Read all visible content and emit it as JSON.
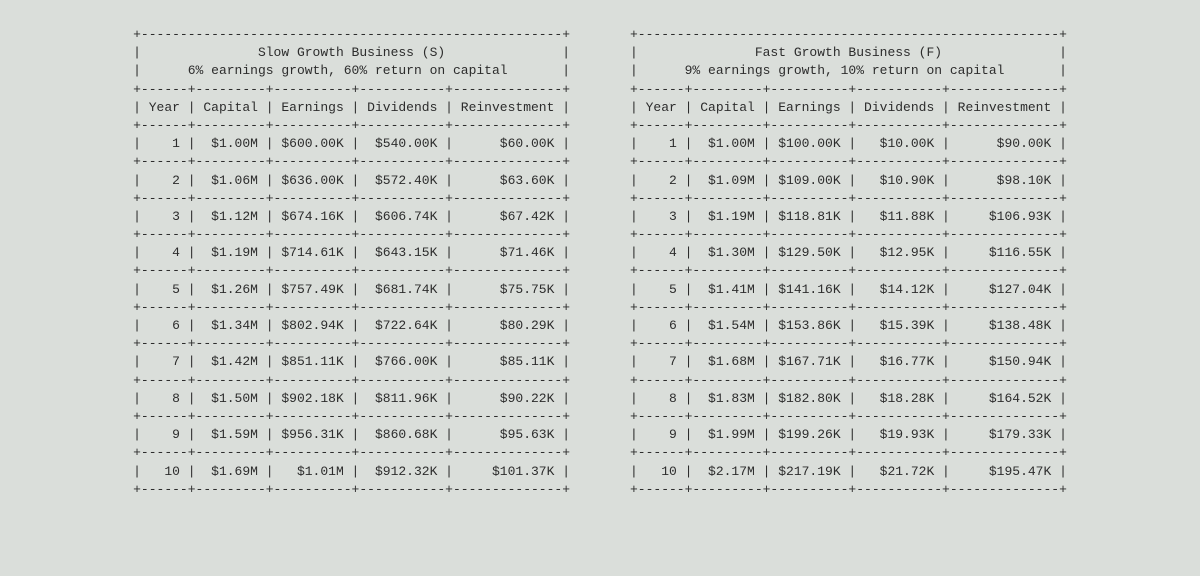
{
  "colors": {
    "bg": "#dadeda",
    "fg": "#2c2c2c"
  },
  "column_widths": {
    "year": 6,
    "capital": 9,
    "earnings": 10,
    "dividends": 11,
    "reinvestment": 14
  },
  "chart_data": [
    {
      "type": "table",
      "title": "Slow Growth Business (S)",
      "subtitle": "6% earnings growth, 60% return on capital",
      "columns": [
        "Year",
        "Capital",
        "Earnings",
        "Dividends",
        "Reinvestment"
      ],
      "rows": [
        {
          "year": 1,
          "capital": "$1.00M",
          "earnings": "$600.00K",
          "dividends": "$540.00K",
          "reinvestment": "$60.00K"
        },
        {
          "year": 2,
          "capital": "$1.06M",
          "earnings": "$636.00K",
          "dividends": "$572.40K",
          "reinvestment": "$63.60K"
        },
        {
          "year": 3,
          "capital": "$1.12M",
          "earnings": "$674.16K",
          "dividends": "$606.74K",
          "reinvestment": "$67.42K"
        },
        {
          "year": 4,
          "capital": "$1.19M",
          "earnings": "$714.61K",
          "dividends": "$643.15K",
          "reinvestment": "$71.46K"
        },
        {
          "year": 5,
          "capital": "$1.26M",
          "earnings": "$757.49K",
          "dividends": "$681.74K",
          "reinvestment": "$75.75K"
        },
        {
          "year": 6,
          "capital": "$1.34M",
          "earnings": "$802.94K",
          "dividends": "$722.64K",
          "reinvestment": "$80.29K"
        },
        {
          "year": 7,
          "capital": "$1.42M",
          "earnings": "$851.11K",
          "dividends": "$766.00K",
          "reinvestment": "$85.11K"
        },
        {
          "year": 8,
          "capital": "$1.50M",
          "earnings": "$902.18K",
          "dividends": "$811.96K",
          "reinvestment": "$90.22K"
        },
        {
          "year": 9,
          "capital": "$1.59M",
          "earnings": "$956.31K",
          "dividends": "$860.68K",
          "reinvestment": "$95.63K"
        },
        {
          "year": 10,
          "capital": "$1.69M",
          "earnings": "$1.01M",
          "dividends": "$912.32K",
          "reinvestment": "$101.37K"
        }
      ]
    },
    {
      "type": "table",
      "title": "Fast Growth Business (F)",
      "subtitle": "9% earnings growth, 10% return on capital",
      "columns": [
        "Year",
        "Capital",
        "Earnings",
        "Dividends",
        "Reinvestment"
      ],
      "rows": [
        {
          "year": 1,
          "capital": "$1.00M",
          "earnings": "$100.00K",
          "dividends": "$10.00K",
          "reinvestment": "$90.00K"
        },
        {
          "year": 2,
          "capital": "$1.09M",
          "earnings": "$109.00K",
          "dividends": "$10.90K",
          "reinvestment": "$98.10K"
        },
        {
          "year": 3,
          "capital": "$1.19M",
          "earnings": "$118.81K",
          "dividends": "$11.88K",
          "reinvestment": "$106.93K"
        },
        {
          "year": 4,
          "capital": "$1.30M",
          "earnings": "$129.50K",
          "dividends": "$12.95K",
          "reinvestment": "$116.55K"
        },
        {
          "year": 5,
          "capital": "$1.41M",
          "earnings": "$141.16K",
          "dividends": "$14.12K",
          "reinvestment": "$127.04K"
        },
        {
          "year": 6,
          "capital": "$1.54M",
          "earnings": "$153.86K",
          "dividends": "$15.39K",
          "reinvestment": "$138.48K"
        },
        {
          "year": 7,
          "capital": "$1.68M",
          "earnings": "$167.71K",
          "dividends": "$16.77K",
          "reinvestment": "$150.94K"
        },
        {
          "year": 8,
          "capital": "$1.83M",
          "earnings": "$182.80K",
          "dividends": "$18.28K",
          "reinvestment": "$164.52K"
        },
        {
          "year": 9,
          "capital": "$1.99M",
          "earnings": "$199.26K",
          "dividends": "$19.93K",
          "reinvestment": "$179.33K"
        },
        {
          "year": 10,
          "capital": "$2.17M",
          "earnings": "$217.19K",
          "dividends": "$21.72K",
          "reinvestment": "$195.47K"
        }
      ]
    }
  ]
}
